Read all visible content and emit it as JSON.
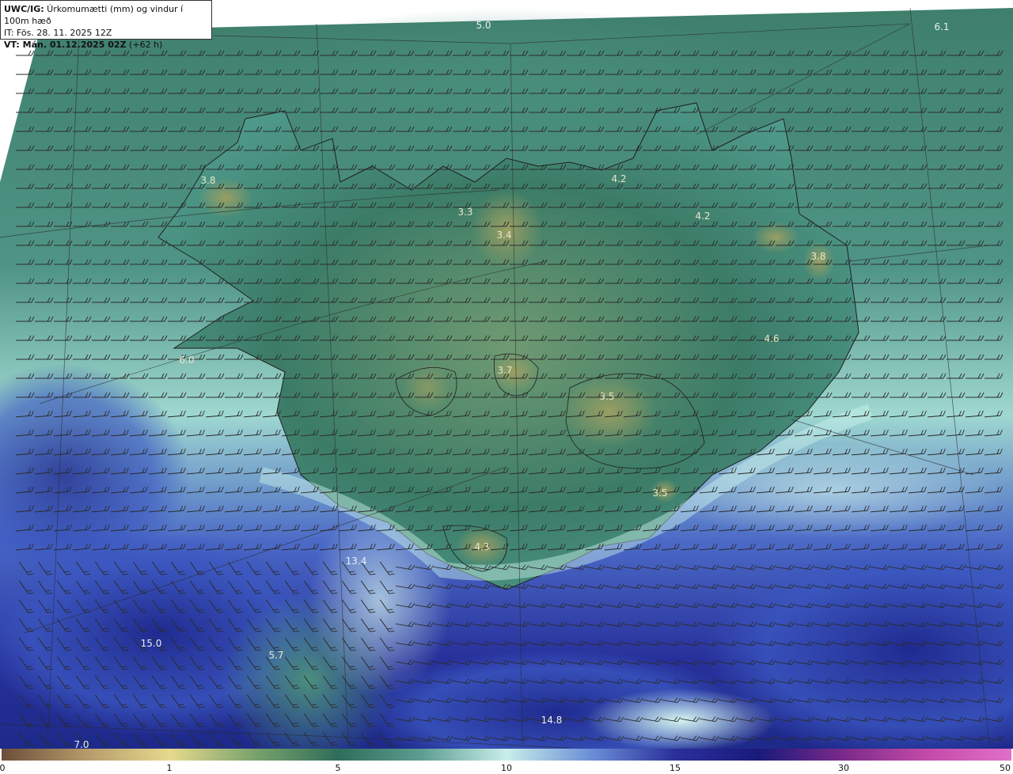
{
  "title": {
    "product": "UWC/IG:",
    "description": " Úrkomumætti (mm) og vindur í 100m hæð",
    "init_time": "IT: Fös. 28. 11. 2025 12Z",
    "valid_label": "VT: Mán. 01.12.2025 02Z",
    "valid_offset": " (+62 h)"
  },
  "map_labels": [
    {
      "text": "5.0",
      "pos": "top-center"
    },
    {
      "text": "6.1",
      "pos": "top-right"
    },
    {
      "text": "3.8",
      "pos": "westfjords"
    },
    {
      "text": "4.2",
      "pos": "north-east-1"
    },
    {
      "text": "4.2",
      "pos": "north-east-2"
    },
    {
      "text": "3.3",
      "pos": "north-1"
    },
    {
      "text": "3.4",
      "pos": "north-2"
    },
    {
      "text": "3.8",
      "pos": "east"
    },
    {
      "text": "4.6",
      "pos": "east-south"
    },
    {
      "text": "3.7",
      "pos": "central"
    },
    {
      "text": "6.0",
      "pos": "west"
    },
    {
      "text": "3.5",
      "pos": "vatnajokull"
    },
    {
      "text": "3.5",
      "pos": "south-east"
    },
    {
      "text": "4.3",
      "pos": "south"
    },
    {
      "text": "13.4",
      "pos": "sea-south"
    },
    {
      "text": "15.0",
      "pos": "sea-southwest"
    },
    {
      "text": "5.7",
      "pos": "sea-south-2"
    },
    {
      "text": "14.8",
      "pos": "sea-bottom"
    },
    {
      "text": "7.0",
      "pos": "bottom-left"
    }
  ],
  "colorbar": {
    "ticks": [
      "0",
      "1",
      "5",
      "10",
      "15",
      "30",
      "50"
    ],
    "colors": [
      "#6b4e3a",
      "#b59a6a",
      "#e6d98e",
      "#7aa36c",
      "#2f6d5a",
      "#5e9e92",
      "#c9eeea",
      "#6b8fd6",
      "#2a2f9a",
      "#1a1a7a",
      "#7a2a8a",
      "#c44aa8",
      "#e070c8"
    ]
  }
}
